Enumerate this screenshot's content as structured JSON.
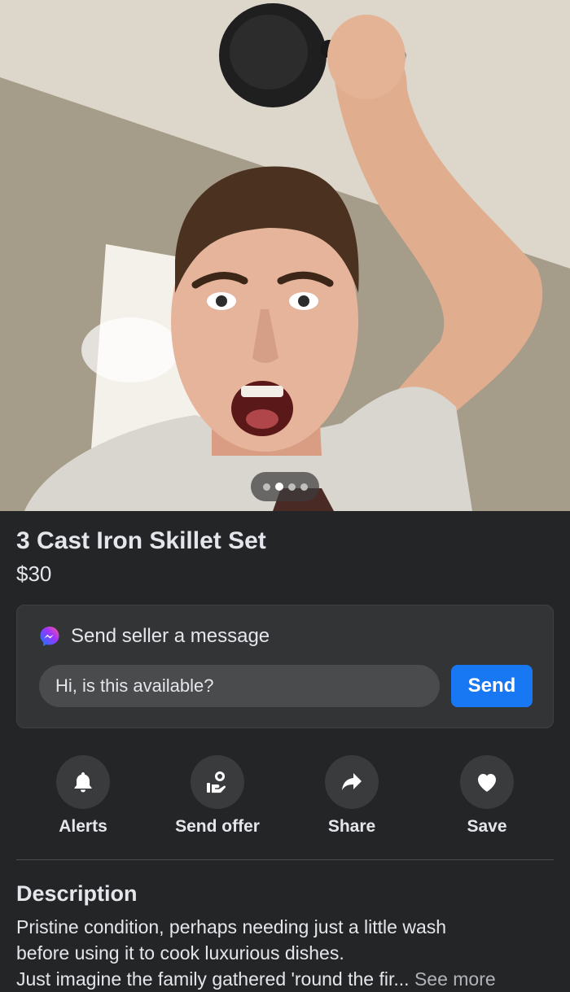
{
  "listing": {
    "title": "3 Cast Iron Skillet Set",
    "price": "$30"
  },
  "photo": {
    "carousel_total": 4,
    "carousel_active_index": 1
  },
  "message_card": {
    "header": "Send seller a message",
    "input_value": "Hi, is this available?",
    "send_label": "Send"
  },
  "actions": [
    {
      "label": "Alerts",
      "icon": "bell-icon"
    },
    {
      "label": "Send offer",
      "icon": "offer-icon"
    },
    {
      "label": "Share",
      "icon": "share-arrow-icon"
    },
    {
      "label": "Save",
      "icon": "heart-icon"
    }
  ],
  "description": {
    "heading": "Description",
    "line1": "Pristine condition, perhaps needing just a little wash",
    "line2": "before using it to cook luxurious dishes.",
    "line3": "Just imagine the family gathered 'round the fir...",
    "see_more": "See more"
  },
  "colors": {
    "background": "#242526",
    "card": "#333436",
    "accent": "#1877f2",
    "text": "#e4e6eb"
  }
}
